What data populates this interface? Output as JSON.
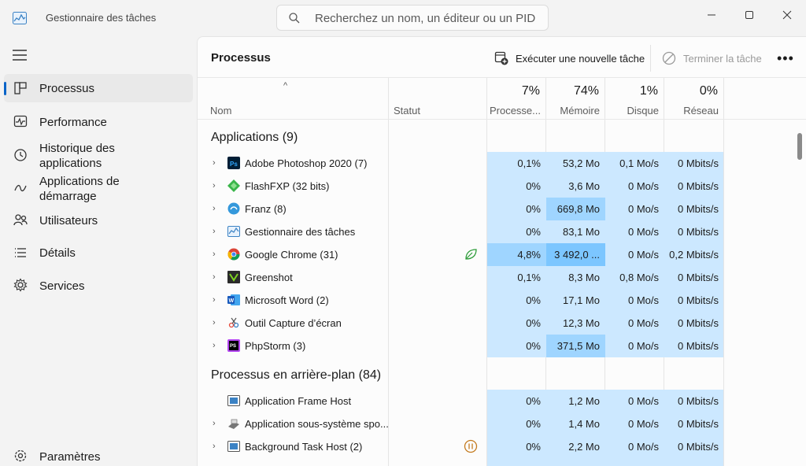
{
  "window": {
    "title": "Gestionnaire des tâches",
    "search_placeholder": "Recherchez un nom, un éditeur ou un PID"
  },
  "sidebar": {
    "items": [
      {
        "label": "Processus",
        "icon": "processes-icon",
        "active": true
      },
      {
        "label": "Performance",
        "icon": "performance-icon"
      },
      {
        "label": "Historique des applications",
        "line1": "Historique des",
        "line2": "applications",
        "icon": "history-icon"
      },
      {
        "label": "Applications de démarrage",
        "line1": "Applications de",
        "line2": "démarrage",
        "icon": "startup-icon"
      },
      {
        "label": "Utilisateurs",
        "icon": "users-icon"
      },
      {
        "label": "Détails",
        "icon": "details-icon"
      },
      {
        "label": "Services",
        "icon": "services-icon"
      }
    ],
    "settings_label": "Paramètres"
  },
  "toolbar": {
    "page_title": "Processus",
    "run_task_label": "Exécuter une nouvelle tâche",
    "end_task_label": "Terminer la tâche",
    "more_label": "•••"
  },
  "columns": {
    "name": "Nom",
    "status": "Statut",
    "cpu": {
      "pct": "7%",
      "label": "Processe..."
    },
    "memory": {
      "pct": "74%",
      "label": "Mémoire"
    },
    "disk": {
      "pct": "1%",
      "label": "Disque"
    },
    "network": {
      "pct": "0%",
      "label": "Réseau"
    }
  },
  "groups": {
    "apps_title": "Applications (9)",
    "background_title": "Processus en arrière-plan (84)"
  },
  "apps": [
    {
      "name": "Adobe Photoshop 2020 (7)",
      "cpu": "0,1%",
      "mem": "53,2 Mo",
      "disk": "0,1 Mo/s",
      "net": "0 Mbits/s"
    },
    {
      "name": "FlashFXP (32 bits)",
      "cpu": "0%",
      "mem": "3,6 Mo",
      "disk": "0 Mo/s",
      "net": "0 Mbits/s"
    },
    {
      "name": "Franz (8)",
      "cpu": "0%",
      "mem": "669,8 Mo",
      "disk": "0 Mo/s",
      "net": "0 Mbits/s"
    },
    {
      "name": "Gestionnaire des tâches",
      "cpu": "0%",
      "mem": "83,1 Mo",
      "disk": "0 Mo/s",
      "net": "0 Mbits/s"
    },
    {
      "name": "Google Chrome (31)",
      "cpu": "4,8%",
      "mem": "3 492,0 ...",
      "disk": "0 Mo/s",
      "net": "0,2 Mbits/s"
    },
    {
      "name": "Greenshot",
      "cpu": "0,1%",
      "mem": "8,3 Mo",
      "disk": "0,8 Mo/s",
      "net": "0 Mbits/s"
    },
    {
      "name": "Microsoft Word (2)",
      "cpu": "0%",
      "mem": "17,1 Mo",
      "disk": "0 Mo/s",
      "net": "0 Mbits/s"
    },
    {
      "name": "Outil Capture d’écran",
      "cpu": "0%",
      "mem": "12,3 Mo",
      "disk": "0 Mo/s",
      "net": "0 Mbits/s"
    },
    {
      "name": "PhpStorm (3)",
      "cpu": "0%",
      "mem": "371,5 Mo",
      "disk": "0 Mo/s",
      "net": "0 Mbits/s"
    }
  ],
  "background": [
    {
      "name": "Application Frame Host",
      "cpu": "0%",
      "mem": "1,2 Mo",
      "disk": "0 Mo/s",
      "net": "0 Mbits/s"
    },
    {
      "name": "Application sous-système spo...",
      "cpu": "0%",
      "mem": "1,4 Mo",
      "disk": "0 Mo/s",
      "net": "0 Mbits/s"
    },
    {
      "name": "Background Task Host (2)",
      "cpu": "0%",
      "mem": "2,2 Mo",
      "disk": "0 Mo/s",
      "net": "0 Mbits/s"
    }
  ],
  "colors": {
    "accent": "#0a64c8",
    "heat_light": "#cce8ff",
    "heat_dark": "#9fd5ff",
    "efficiency_green": "#2e9d3a",
    "paused_orange": "#c47a1e"
  }
}
